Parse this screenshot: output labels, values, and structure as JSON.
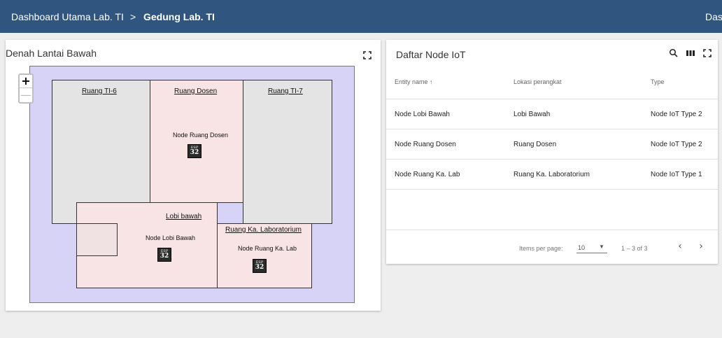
{
  "header": {
    "root_label": "Dashboard Utama Lab. TI",
    "separator": ">",
    "current_label": "Gedung Lab. TI",
    "right_label": "Dashboard"
  },
  "map_widget": {
    "title": "Denah Lantai Bawah",
    "zoom_in": "+",
    "zoom_out": "—",
    "rooms": {
      "ti6": "Ruang TI-6",
      "dosen": "Ruang Dosen",
      "ti7": "Ruang TI-7",
      "lobi": "Lobi bawah",
      "kalab": "Ruang Ka. Laboratorium"
    },
    "nodes": {
      "dosen": "Node Ruang Dosen",
      "lobi": "Node Lobi Bawah",
      "kalab": "Node Ruang Ka. Lab"
    },
    "esp_icon": {
      "line1": "ESP",
      "line2": "32"
    }
  },
  "table_widget": {
    "title": "Daftar Node IoT",
    "columns": [
      "Entity name ↑",
      "Lokasi perangkat",
      "Type"
    ],
    "rows": [
      [
        "Node Lobi Bawah",
        "Lobi Bawah",
        "Node IoT Type 2"
      ],
      [
        "Node Ruang Dosen",
        "Ruang Dosen",
        "Node IoT Type 2"
      ],
      [
        "Node Ruang Ka. Lab",
        "Ruang Ka. Laboratorium",
        "Node IoT Type 1"
      ]
    ],
    "pagination": {
      "items_per_page_label": "Items per page:",
      "items_per_page_value": "10",
      "dropdown_arrow": "▼",
      "range_label": "1 – 3 of 3",
      "prev": "‹",
      "next": "›"
    }
  },
  "colors": {
    "header_bg": "#305680",
    "map_bg": "#d7d3f7",
    "room_gray": "#e4e4e4",
    "room_pink": "#f8e4e4"
  }
}
